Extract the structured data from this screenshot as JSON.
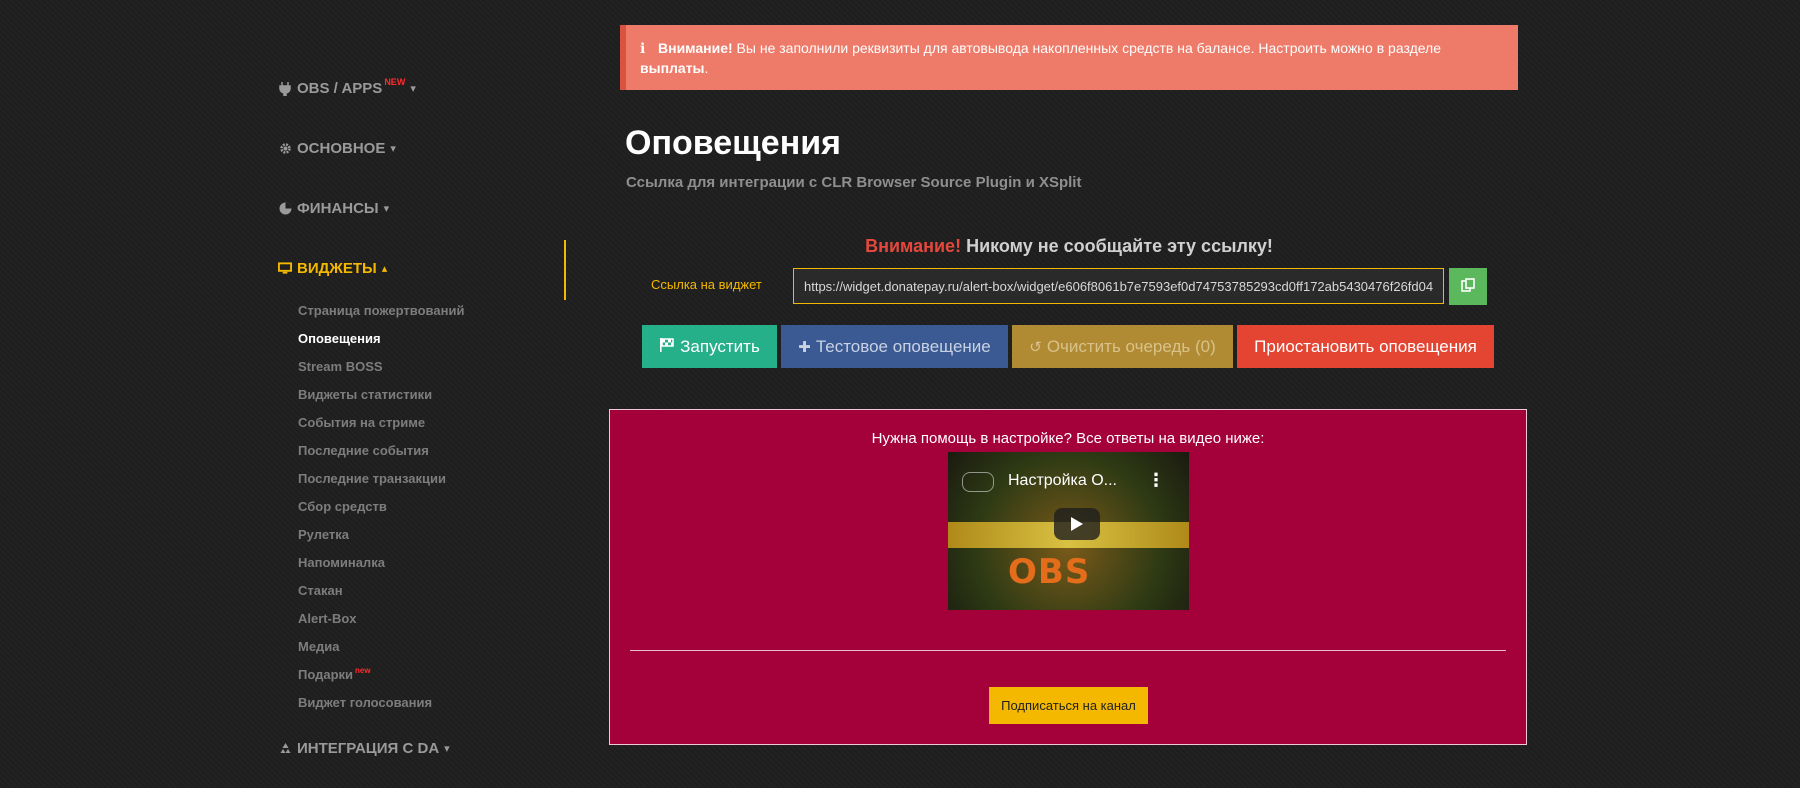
{
  "sidebar": {
    "sections": [
      {
        "label": "OBS / APPS",
        "badge": "NEW",
        "caret": "▾",
        "icon": "plug-icon"
      },
      {
        "label": "ОСНОВНОЕ",
        "caret": "▾",
        "icon": "gear-icon"
      },
      {
        "label": "ФИНАНСЫ",
        "caret": "▾",
        "icon": "pie-chart-icon"
      },
      {
        "label": "ВИДЖЕТЫ",
        "caret": "▴",
        "icon": "monitor-icon"
      },
      {
        "label": "ИНТЕГРАЦИЯ С DA",
        "caret": "▾",
        "icon": "recycle-icon"
      }
    ],
    "items": [
      {
        "label": "Страница пожертвований"
      },
      {
        "label": "Оповещения"
      },
      {
        "label": "Stream BOSS"
      },
      {
        "label": "Виджеты статистики"
      },
      {
        "label": "События на стриме"
      },
      {
        "label": "Последние события"
      },
      {
        "label": "Последние транзакции"
      },
      {
        "label": "Сбор средств"
      },
      {
        "label": "Рулетка"
      },
      {
        "label": "Напоминалка"
      },
      {
        "label": "Стакан"
      },
      {
        "label": "Alert-Box"
      },
      {
        "label": "Медиа"
      },
      {
        "label": "Подарки",
        "badge": "new"
      },
      {
        "label": "Виджет голосования"
      }
    ]
  },
  "alert": {
    "icon": "ℹ",
    "bold": "Внимание!",
    "text": "Вы не заполнили реквизиты для автовывода накопленных средств на балансе. Настроить можно в разделе",
    "link": "выплаты",
    "end": "."
  },
  "header": {
    "title": "Оповещения",
    "subtitle": "Ссылка для интеграции с CLR Browser Source Plugin и XSplit"
  },
  "warning": {
    "red": "Внимание!",
    "text": "Никому не сообщайте эту ссылку!"
  },
  "widget_link": {
    "label": "Ссылка на виджет",
    "value": "https://widget.donatepay.ru/alert-box/widget/e606f8061b7e7593ef0d74753785293cd0ff172ab5430476f26fd04"
  },
  "buttons": {
    "start": "Запустить",
    "test": "Тестовое оповещение",
    "clear": "Очистить очередь (0)",
    "pause": "Приостановить оповещения"
  },
  "help": {
    "text": "Нужна помощь в настройке? Все ответы на видео ниже:",
    "video_title": "Настройка О...",
    "video_overlay": "OBS",
    "subscribe": "Подписаться на канал"
  },
  "colors": {
    "accent": "#f5b800",
    "alert_bg": "#ee7b69",
    "help_bg": "#a4003a",
    "start": "#26b08a",
    "test": "#3b5a93",
    "clear": "#b18a34",
    "pause": "#e34532"
  }
}
